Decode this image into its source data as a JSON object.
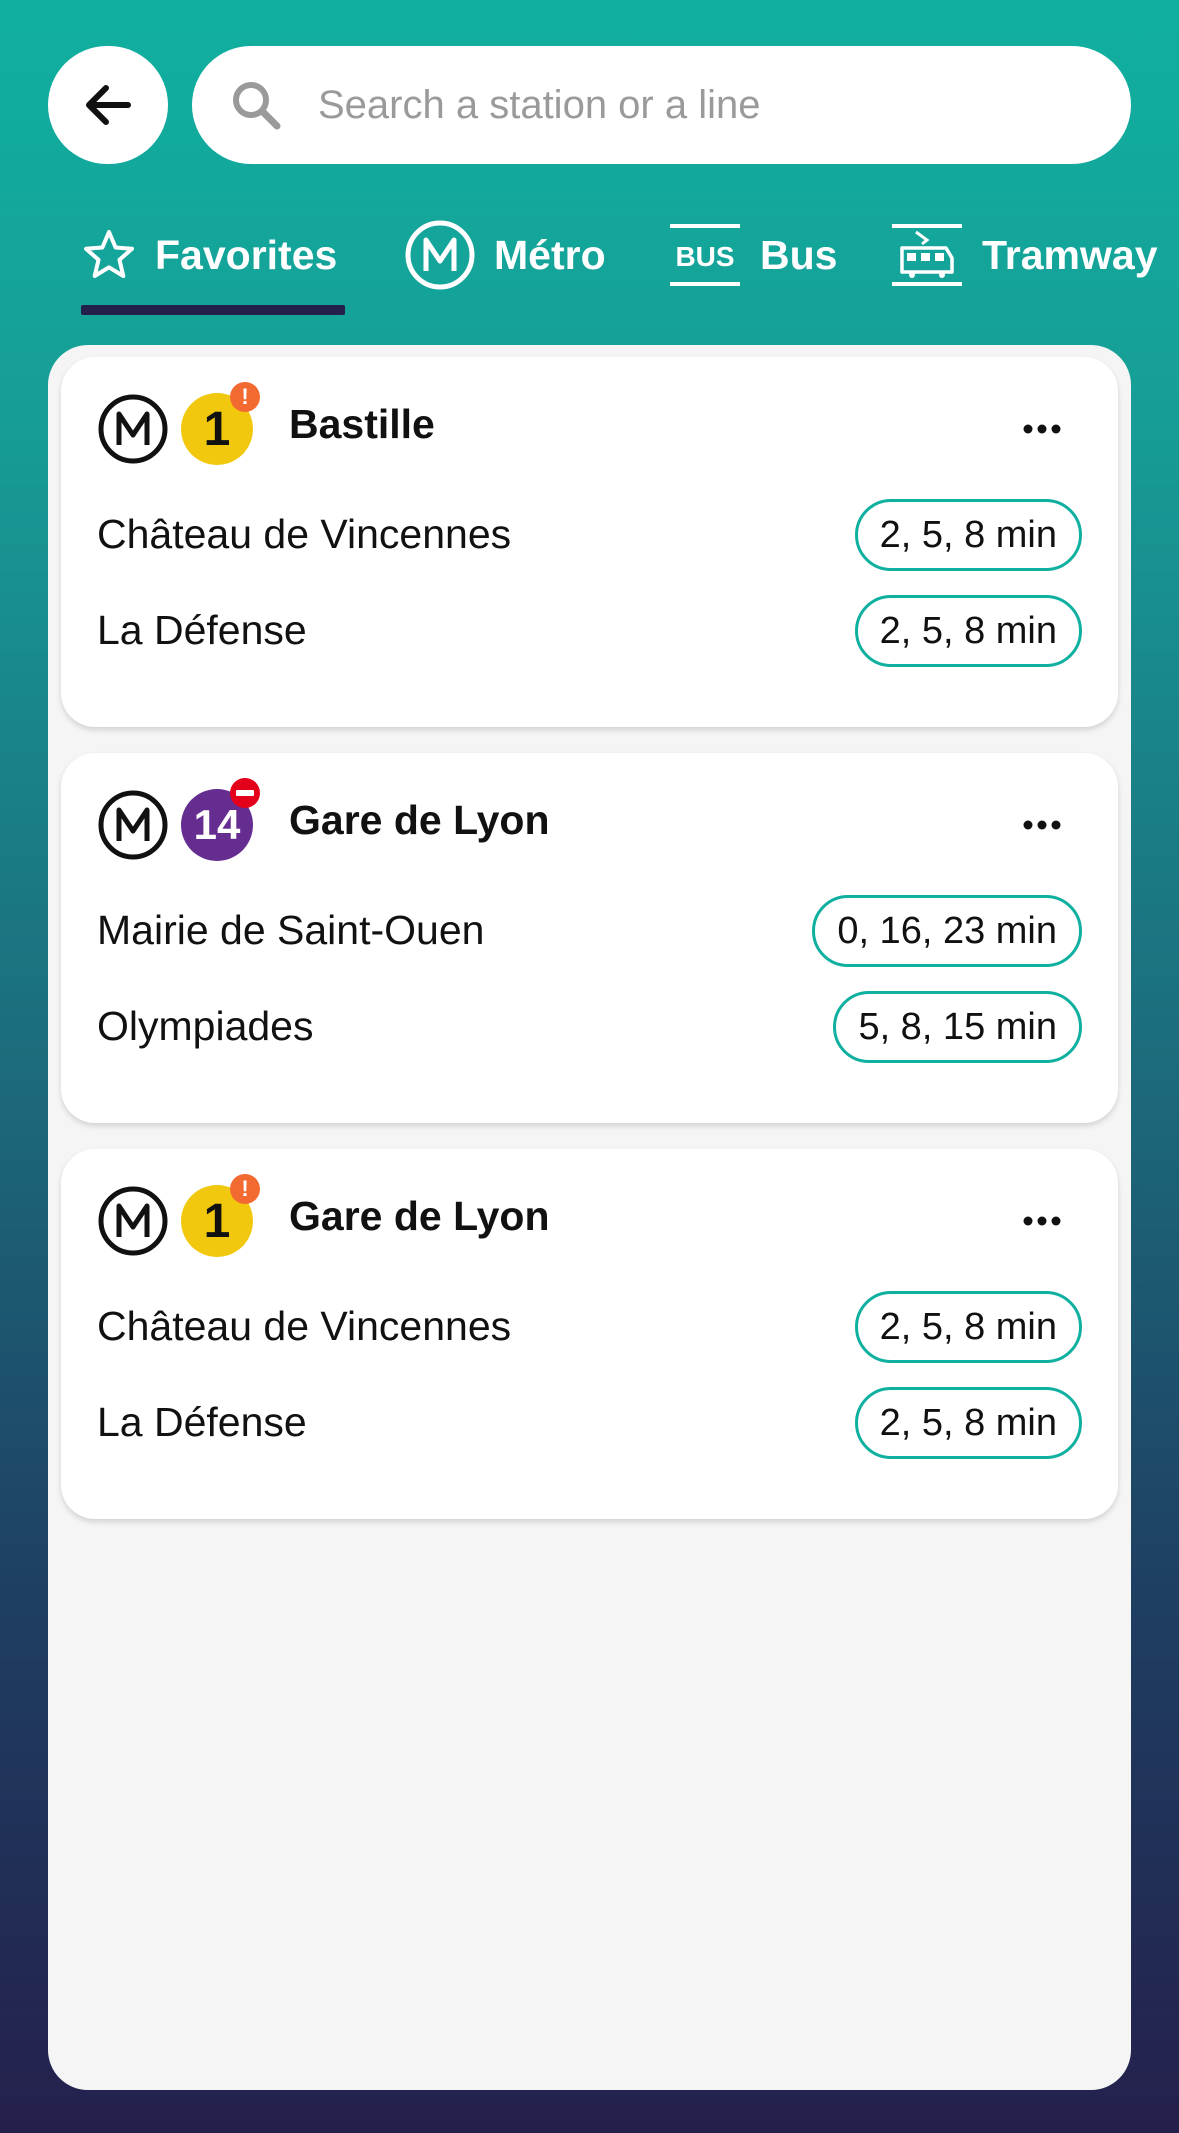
{
  "search": {
    "placeholder": "Search a station or a line"
  },
  "tabs": [
    {
      "label": "Favorites",
      "icon": "star-icon",
      "active": true
    },
    {
      "label": "Métro",
      "icon": "metro-icon",
      "active": false
    },
    {
      "label": "Bus",
      "icon": "bus-icon",
      "icon_text": "BUS",
      "active": false
    },
    {
      "label": "Tramway",
      "icon": "tram-icon",
      "active": false
    }
  ],
  "favorites": [
    {
      "mode_icon": "metro-icon",
      "line": "1",
      "line_color": "#f2c80f",
      "line_text_color": "#111111",
      "alert": "warning",
      "alert_color": "#f26a30",
      "alert_symbol": "!",
      "station": "Bastille",
      "directions": [
        {
          "name": "Château de Vincennes",
          "times": "2, 5, 8 min"
        },
        {
          "name": "La Défense",
          "times": "2, 5, 8 min"
        }
      ]
    },
    {
      "mode_icon": "metro-icon",
      "line": "14",
      "line_color": "#662d91",
      "line_text_color": "#ffffff",
      "alert": "disruption",
      "alert_color": "#e3001b",
      "alert_symbol": "−",
      "station": "Gare de Lyon",
      "directions": [
        {
          "name": "Mairie de Saint-Ouen",
          "times": "0, 16, 23 min"
        },
        {
          "name": "Olympiades",
          "times": "5, 8, 15 min"
        }
      ]
    },
    {
      "mode_icon": "metro-icon",
      "line": "1",
      "line_color": "#f2c80f",
      "line_text_color": "#111111",
      "alert": "warning",
      "alert_color": "#f26a30",
      "alert_symbol": "!",
      "station": "Gare de Lyon",
      "directions": [
        {
          "name": "Château de Vincennes",
          "times": "2, 5, 8 min"
        },
        {
          "name": "La Défense",
          "times": "2, 5, 8 min"
        }
      ]
    }
  ],
  "colors": {
    "accent": "#10b0a0",
    "tab_indicator": "#24204c",
    "card_background": "#ffffff",
    "panel_background": "#f5f5f5"
  }
}
